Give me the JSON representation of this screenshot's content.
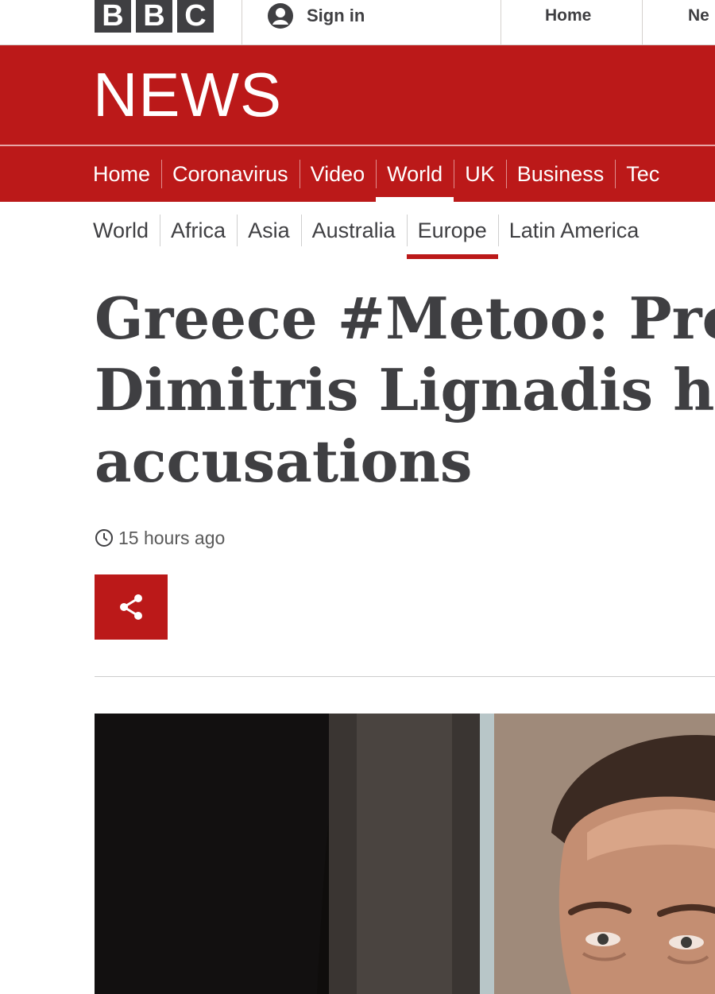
{
  "header": {
    "logo_letters": [
      "B",
      "B",
      "C"
    ],
    "sign_in_label": "Sign in",
    "nav": [
      {
        "label": "Home"
      },
      {
        "label": "Ne"
      }
    ]
  },
  "banner": {
    "wordmark": "NEWS"
  },
  "primary_nav": {
    "items": [
      {
        "label": "Home"
      },
      {
        "label": "Coronavirus"
      },
      {
        "label": "Video"
      },
      {
        "label": "World",
        "active": true
      },
      {
        "label": "UK"
      },
      {
        "label": "Business"
      },
      {
        "label": "Tec"
      }
    ]
  },
  "secondary_nav": {
    "items": [
      {
        "label": "World"
      },
      {
        "label": "Africa"
      },
      {
        "label": "Asia"
      },
      {
        "label": "Australia"
      },
      {
        "label": "Europe",
        "active": true
      },
      {
        "label": "Latin America"
      }
    ]
  },
  "article": {
    "headline_lines": [
      "Greece #Metoo: Pro",
      "Dimitris Lignadis he",
      "accusations"
    ],
    "timestamp": "15 hours ago",
    "lead_image_icon": "photo-of-man"
  },
  "colors": {
    "brand_red": "#bb1919",
    "text": "#3f3f42",
    "logo_block": "#3f3f42"
  }
}
